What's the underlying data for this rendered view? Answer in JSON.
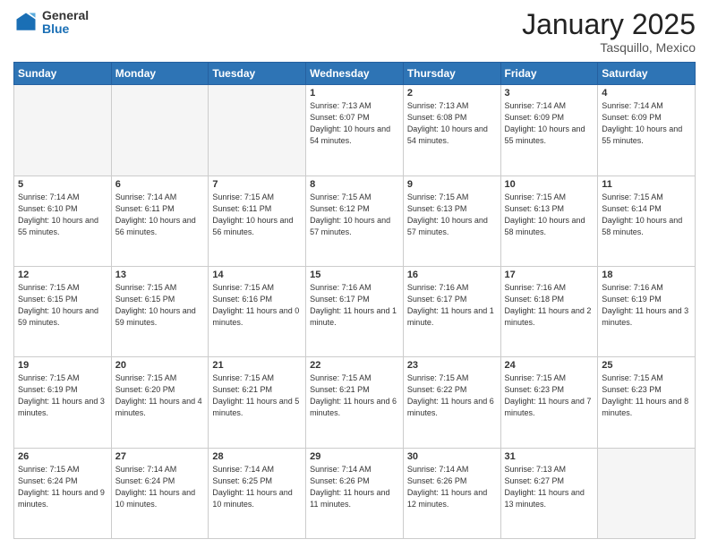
{
  "header": {
    "logo_general": "General",
    "logo_blue": "Blue",
    "month_title": "January 2025",
    "location": "Tasquillo, Mexico"
  },
  "weekdays": [
    "Sunday",
    "Monday",
    "Tuesday",
    "Wednesday",
    "Thursday",
    "Friday",
    "Saturday"
  ],
  "weeks": [
    [
      {
        "day": "",
        "info": ""
      },
      {
        "day": "",
        "info": ""
      },
      {
        "day": "",
        "info": ""
      },
      {
        "day": "1",
        "info": "Sunrise: 7:13 AM\nSunset: 6:07 PM\nDaylight: 10 hours\nand 54 minutes."
      },
      {
        "day": "2",
        "info": "Sunrise: 7:13 AM\nSunset: 6:08 PM\nDaylight: 10 hours\nand 54 minutes."
      },
      {
        "day": "3",
        "info": "Sunrise: 7:14 AM\nSunset: 6:09 PM\nDaylight: 10 hours\nand 55 minutes."
      },
      {
        "day": "4",
        "info": "Sunrise: 7:14 AM\nSunset: 6:09 PM\nDaylight: 10 hours\nand 55 minutes."
      }
    ],
    [
      {
        "day": "5",
        "info": "Sunrise: 7:14 AM\nSunset: 6:10 PM\nDaylight: 10 hours\nand 55 minutes."
      },
      {
        "day": "6",
        "info": "Sunrise: 7:14 AM\nSunset: 6:11 PM\nDaylight: 10 hours\nand 56 minutes."
      },
      {
        "day": "7",
        "info": "Sunrise: 7:15 AM\nSunset: 6:11 PM\nDaylight: 10 hours\nand 56 minutes."
      },
      {
        "day": "8",
        "info": "Sunrise: 7:15 AM\nSunset: 6:12 PM\nDaylight: 10 hours\nand 57 minutes."
      },
      {
        "day": "9",
        "info": "Sunrise: 7:15 AM\nSunset: 6:13 PM\nDaylight: 10 hours\nand 57 minutes."
      },
      {
        "day": "10",
        "info": "Sunrise: 7:15 AM\nSunset: 6:13 PM\nDaylight: 10 hours\nand 58 minutes."
      },
      {
        "day": "11",
        "info": "Sunrise: 7:15 AM\nSunset: 6:14 PM\nDaylight: 10 hours\nand 58 minutes."
      }
    ],
    [
      {
        "day": "12",
        "info": "Sunrise: 7:15 AM\nSunset: 6:15 PM\nDaylight: 10 hours\nand 59 minutes."
      },
      {
        "day": "13",
        "info": "Sunrise: 7:15 AM\nSunset: 6:15 PM\nDaylight: 10 hours\nand 59 minutes."
      },
      {
        "day": "14",
        "info": "Sunrise: 7:15 AM\nSunset: 6:16 PM\nDaylight: 11 hours\nand 0 minutes."
      },
      {
        "day": "15",
        "info": "Sunrise: 7:16 AM\nSunset: 6:17 PM\nDaylight: 11 hours\nand 1 minute."
      },
      {
        "day": "16",
        "info": "Sunrise: 7:16 AM\nSunset: 6:17 PM\nDaylight: 11 hours\nand 1 minute."
      },
      {
        "day": "17",
        "info": "Sunrise: 7:16 AM\nSunset: 6:18 PM\nDaylight: 11 hours\nand 2 minutes."
      },
      {
        "day": "18",
        "info": "Sunrise: 7:16 AM\nSunset: 6:19 PM\nDaylight: 11 hours\nand 3 minutes."
      }
    ],
    [
      {
        "day": "19",
        "info": "Sunrise: 7:15 AM\nSunset: 6:19 PM\nDaylight: 11 hours\nand 3 minutes."
      },
      {
        "day": "20",
        "info": "Sunrise: 7:15 AM\nSunset: 6:20 PM\nDaylight: 11 hours\nand 4 minutes."
      },
      {
        "day": "21",
        "info": "Sunrise: 7:15 AM\nSunset: 6:21 PM\nDaylight: 11 hours\nand 5 minutes."
      },
      {
        "day": "22",
        "info": "Sunrise: 7:15 AM\nSunset: 6:21 PM\nDaylight: 11 hours\nand 6 minutes."
      },
      {
        "day": "23",
        "info": "Sunrise: 7:15 AM\nSunset: 6:22 PM\nDaylight: 11 hours\nand 6 minutes."
      },
      {
        "day": "24",
        "info": "Sunrise: 7:15 AM\nSunset: 6:23 PM\nDaylight: 11 hours\nand 7 minutes."
      },
      {
        "day": "25",
        "info": "Sunrise: 7:15 AM\nSunset: 6:23 PM\nDaylight: 11 hours\nand 8 minutes."
      }
    ],
    [
      {
        "day": "26",
        "info": "Sunrise: 7:15 AM\nSunset: 6:24 PM\nDaylight: 11 hours\nand 9 minutes."
      },
      {
        "day": "27",
        "info": "Sunrise: 7:14 AM\nSunset: 6:24 PM\nDaylight: 11 hours\nand 10 minutes."
      },
      {
        "day": "28",
        "info": "Sunrise: 7:14 AM\nSunset: 6:25 PM\nDaylight: 11 hours\nand 10 minutes."
      },
      {
        "day": "29",
        "info": "Sunrise: 7:14 AM\nSunset: 6:26 PM\nDaylight: 11 hours\nand 11 minutes."
      },
      {
        "day": "30",
        "info": "Sunrise: 7:14 AM\nSunset: 6:26 PM\nDaylight: 11 hours\nand 12 minutes."
      },
      {
        "day": "31",
        "info": "Sunrise: 7:13 AM\nSunset: 6:27 PM\nDaylight: 11 hours\nand 13 minutes."
      },
      {
        "day": "",
        "info": ""
      }
    ]
  ]
}
